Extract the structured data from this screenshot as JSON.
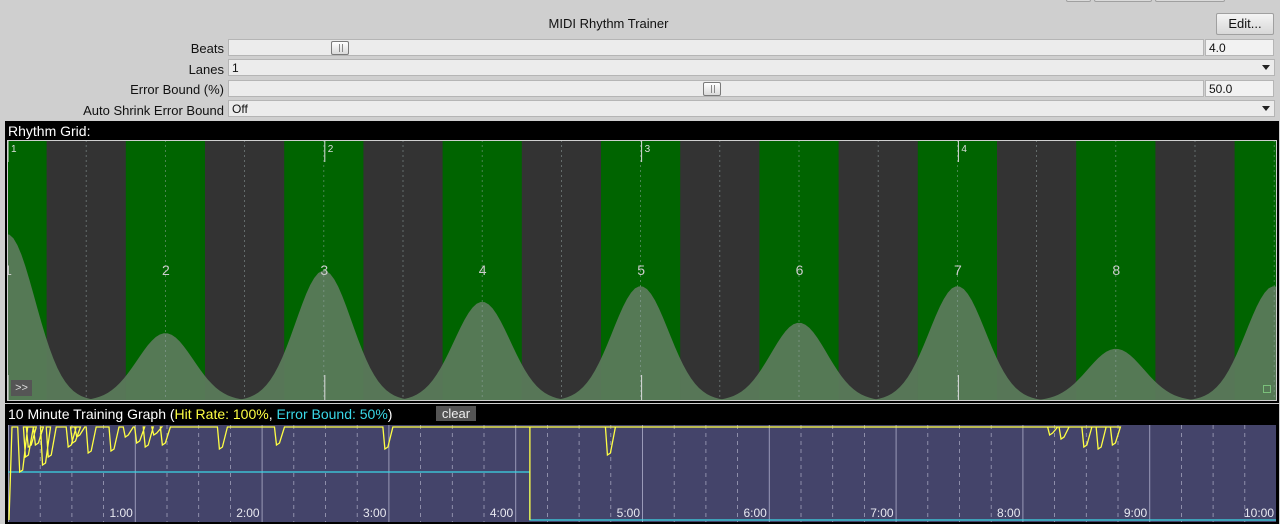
{
  "window": {
    "title": "MIDI Rhythm Trainer",
    "edit_label": "Edit..."
  },
  "settings": {
    "beats": {
      "label": "Beats",
      "value": "4.0",
      "slider_fraction": 0.105
    },
    "lanes": {
      "label": "Lanes",
      "value": "1"
    },
    "error_bound": {
      "label": "Error Bound (%)",
      "value": "50.0",
      "slider_fraction": 0.495
    },
    "auto_shrink": {
      "label": "Auto Shrink Error Bound",
      "value": "Off"
    }
  },
  "rhythm_grid": {
    "title": "Rhythm Grid:",
    "beat_labels": [
      "1",
      "2",
      "3",
      "4"
    ],
    "subdivision_labels": [
      "1",
      "2",
      "3",
      "4",
      "5",
      "6",
      "7",
      "8"
    ],
    "expand_label": ">>",
    "colors": {
      "hit_zone": "#006400",
      "miss_zone": "#333333",
      "histogram": "#5a7a5a"
    }
  },
  "training_graph": {
    "title": "10 Minute Training Graph",
    "hit_rate_text": "Hit Rate: 100%",
    "separator": ",",
    "error_bound_text": "Error Bound: 50%",
    "open_paren": "(",
    "close_paren": ")",
    "clear_label": "clear",
    "time_labels": [
      "1:00",
      "2:00",
      "3:00",
      "4:00",
      "5:00",
      "6:00",
      "7:00",
      "8:00",
      "9:00",
      "10:00"
    ],
    "colors": {
      "background": "#44446a",
      "hit_rate": "#ffff44",
      "error_bound": "#3ad8e8"
    }
  }
}
